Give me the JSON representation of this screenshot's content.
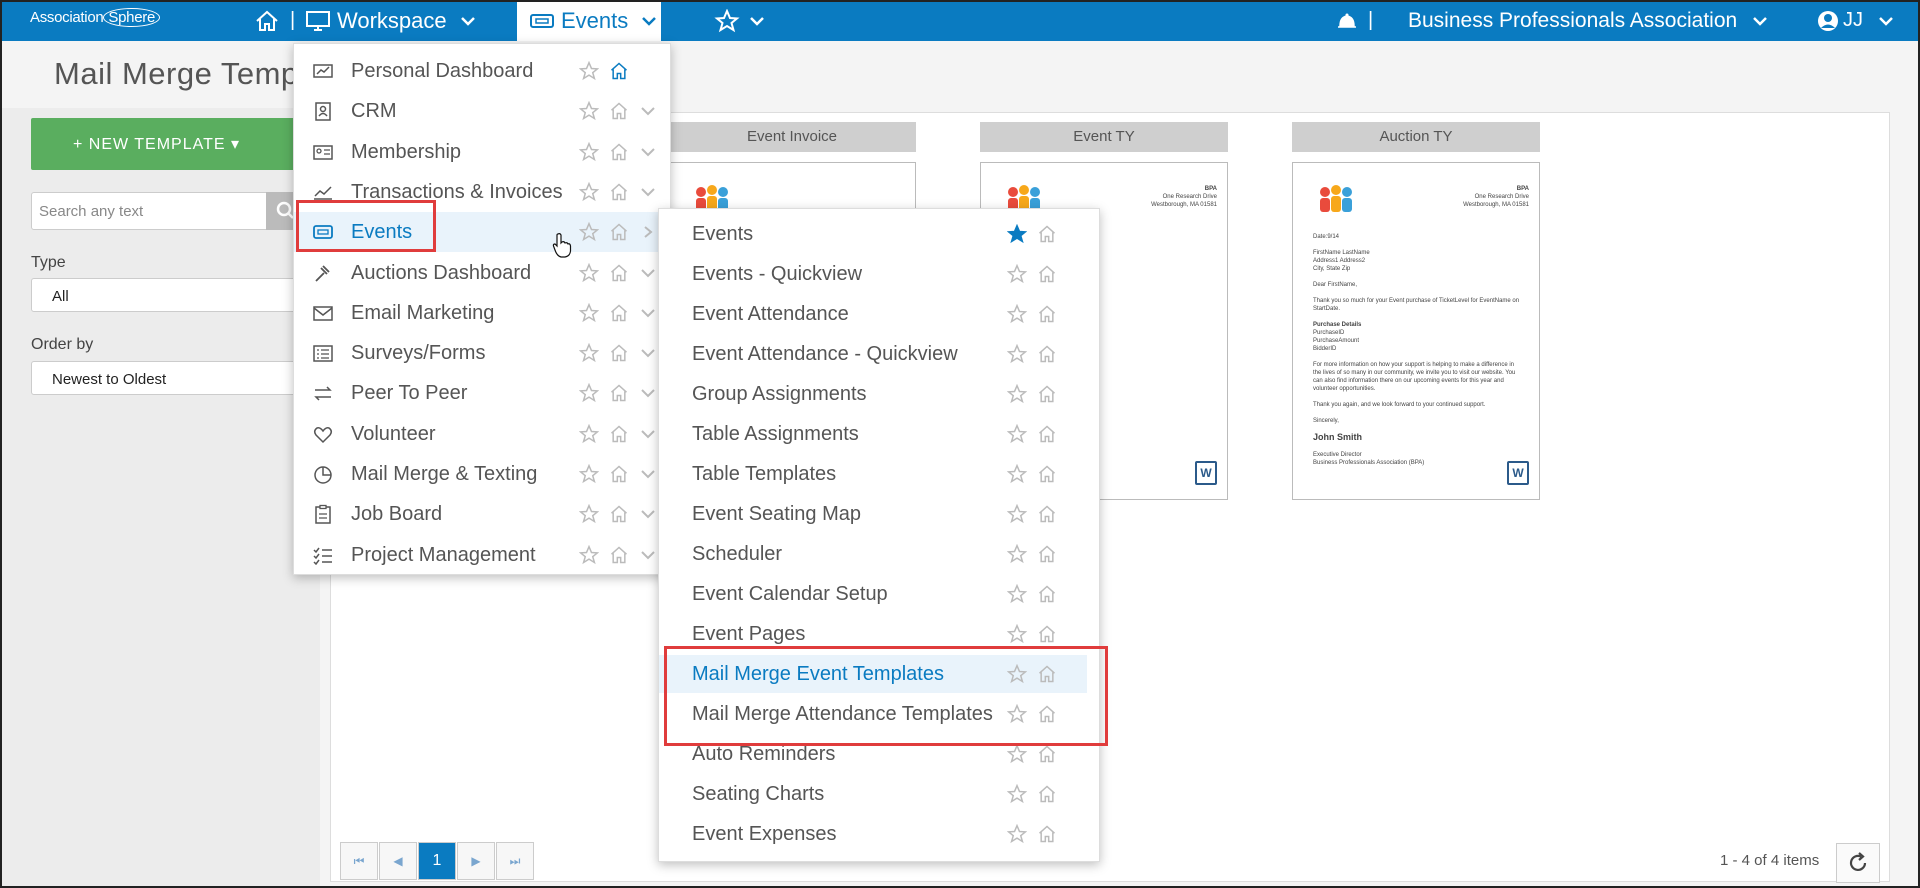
{
  "brand": {
    "logo_a": "Association",
    "logo_b": "Sphere"
  },
  "topbar": {
    "workspace_label": "Workspace",
    "events_label": "Events",
    "org_name": "Business Professionals Association",
    "user_initials": "JJ",
    "separator": "|"
  },
  "page": {
    "title": "Mail Merge Temp",
    "new_template_label": "+ NEW TEMPLATE ▾",
    "search_placeholder": "Search any text",
    "type_label": "Type",
    "type_value": "All",
    "order_label": "Order by",
    "order_value": "Newest to Oldest"
  },
  "cards": [
    {
      "title": "Event Invoice"
    },
    {
      "title": "Event TY"
    },
    {
      "title": "Auction TY"
    }
  ],
  "doc_sample": {
    "org_short": "BPA",
    "address1": "One Research Drive",
    "address2": "Westborough, MA 01581",
    "date": "Date:9/14",
    "recipient1": "FirstName LastName",
    "recipient2": "Address1 Address2",
    "recipient3": "City, State Zip",
    "greeting": "Dear FirstName,",
    "thanks": "Thank you so much for your Event purchase of TicketLevel for EventName on StartDate.",
    "purchase_header": "Purchase Details",
    "purchase_id": "PurchaseID",
    "purchase_amount": "PurchaseAmount",
    "bidder": "BidderID",
    "body": "For more information on how your support is helping to make a difference in the lives of so many in our community, we invite you to visit our website. You can also find information there on our upcoming events for this year and volunteer opportunities.",
    "thanks2": "Thank you again, and we look forward to your continued support.",
    "sincerely": "Sincerely,",
    "signer": "John Smith",
    "signer_title": "Executive Director",
    "signer_org": "Business Professionals Association (BPA)",
    "word_glyph": "W"
  },
  "pager": {
    "current": "1",
    "items": "1 - 4 of 4 items"
  },
  "dropdown_modules": [
    {
      "label": "Personal Dashboard",
      "icon": "dashboard-icon"
    },
    {
      "label": "CRM",
      "icon": "contact-card-icon"
    },
    {
      "label": "Membership",
      "icon": "id-card-icon"
    },
    {
      "label": "Transactions & Invoices",
      "icon": "trend-chart-icon"
    },
    {
      "label": "Events",
      "icon": "ticket-icon"
    },
    {
      "label": "Auctions Dashboard",
      "icon": "gavel-icon"
    },
    {
      "label": "Email Marketing",
      "icon": "envelope-icon"
    },
    {
      "label": "Surveys/Forms",
      "icon": "list-icon"
    },
    {
      "label": "Peer To Peer",
      "icon": "exchange-arrows-icon"
    },
    {
      "label": "Volunteer",
      "icon": "heart-icon"
    },
    {
      "label": "Mail Merge & Texting",
      "icon": "pie-chart-icon"
    },
    {
      "label": "Job Board",
      "icon": "clipboard-icon"
    },
    {
      "label": "Project Management",
      "icon": "checklist-icon"
    }
  ],
  "dropdown_events": [
    {
      "label": "Events",
      "starred": true
    },
    {
      "label": "Events - Quickview"
    },
    {
      "label": "Event Attendance"
    },
    {
      "label": "Event Attendance - Quickview"
    },
    {
      "label": "Group Assignments"
    },
    {
      "label": "Table Assignments"
    },
    {
      "label": "Table Templates"
    },
    {
      "label": "Event Seating Map"
    },
    {
      "label": "Scheduler"
    },
    {
      "label": "Event Calendar Setup"
    },
    {
      "label": "Event Pages"
    },
    {
      "label": "Mail Merge Event Templates"
    },
    {
      "label": "Mail Merge Attendance Templates"
    },
    {
      "label": "Auto Reminders"
    },
    {
      "label": "Seating Charts"
    },
    {
      "label": "Event Expenses"
    }
  ],
  "colors": {
    "brand": "#0a7bc1",
    "highlight": "#e03c3c",
    "new_button": "#5aae5f"
  }
}
